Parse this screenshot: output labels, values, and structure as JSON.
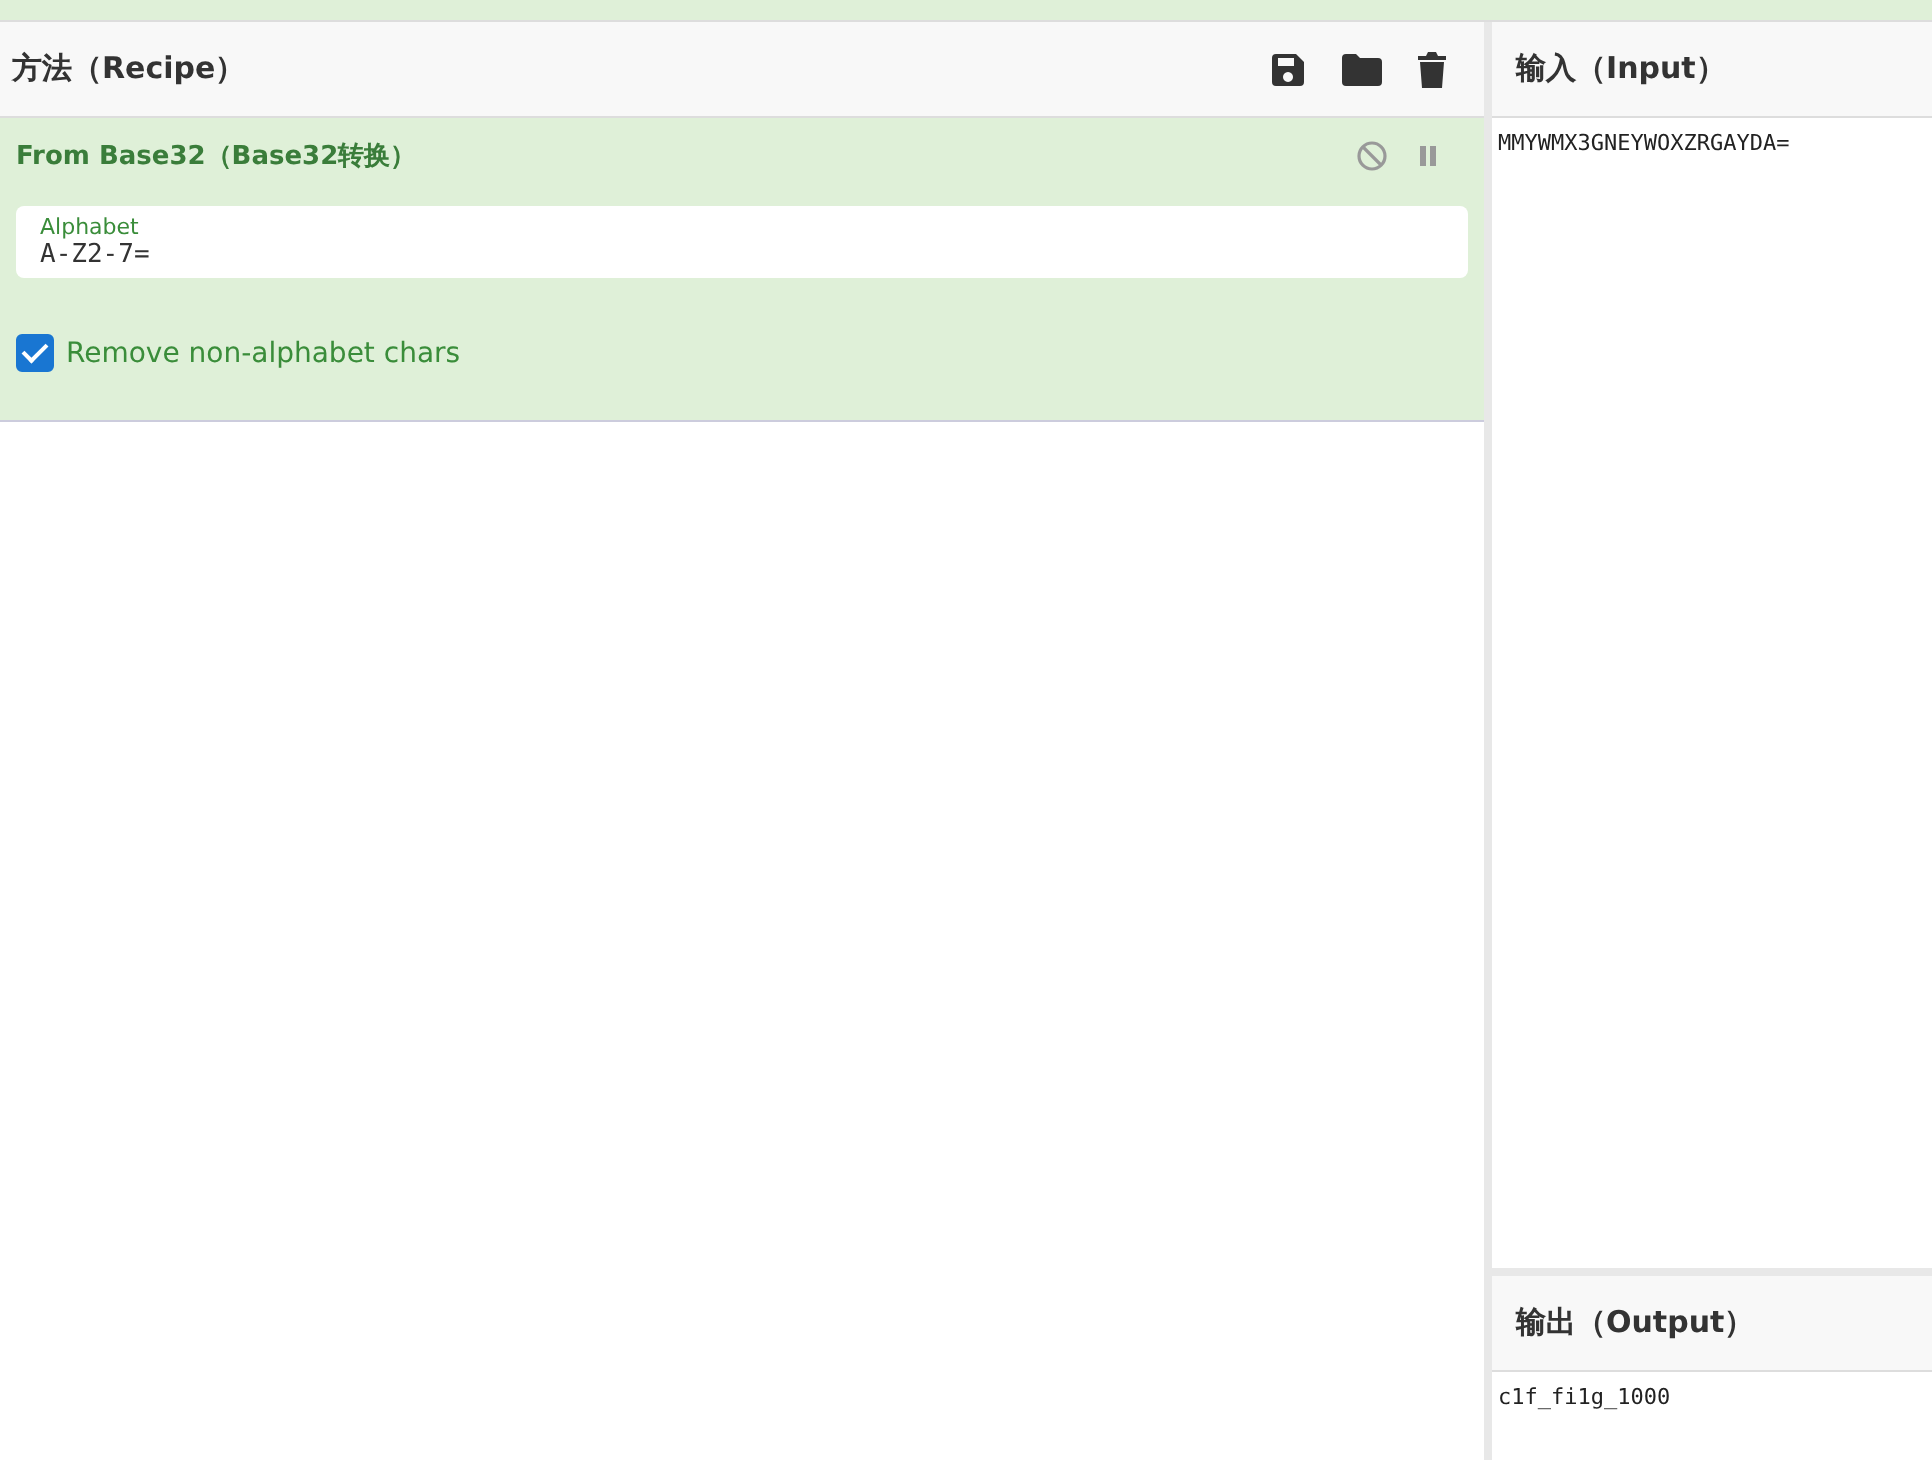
{
  "recipe": {
    "title": "方法（Recipe）",
    "operations": [
      {
        "title": "From Base32（Base32转换）",
        "disabled": false,
        "breakpoint": false,
        "args": [
          {
            "kind": "text",
            "label": "Alphabet",
            "value": "A-Z2-7="
          },
          {
            "kind": "checkbox",
            "label": "Remove non-alphabet chars",
            "checked": true
          }
        ]
      }
    ]
  },
  "input": {
    "title": "输入（Input）",
    "value": "MMYWMX3GNEYWOXZRGAYDA="
  },
  "output": {
    "title": "输出（Output）",
    "value": "c1f_fi1g_1000"
  }
}
